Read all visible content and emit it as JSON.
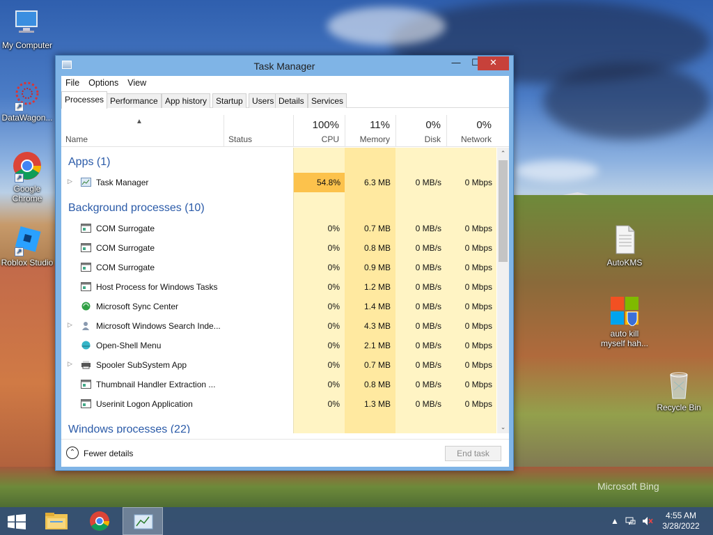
{
  "desktop": {
    "icons": [
      {
        "label": "My Computer"
      },
      {
        "label": "DataWagon..."
      },
      {
        "label": "Google Chrome"
      },
      {
        "label": "Roblox Studio"
      },
      {
        "label": "AutoKMS"
      },
      {
        "label": "auto kill myself hah..."
      },
      {
        "label": "Recycle Bin"
      }
    ],
    "watermark": "Microsoft Bing"
  },
  "window": {
    "title": "Task Manager",
    "controls": {
      "minimize": "—",
      "maximize": "☐",
      "close": "✕"
    },
    "menu": [
      "File",
      "Options",
      "View"
    ],
    "tabs": [
      "Processes",
      "Performance",
      "App history",
      "Startup",
      "Users",
      "Details",
      "Services"
    ],
    "active_tab": "Processes"
  },
  "columns": {
    "name": {
      "label": "Name"
    },
    "status": {
      "label": "Status"
    },
    "cpu": {
      "pct": "100%",
      "label": "CPU"
    },
    "memory": {
      "pct": "11%",
      "label": "Memory"
    },
    "disk": {
      "pct": "0%",
      "label": "Disk"
    },
    "network": {
      "pct": "0%",
      "label": "Network"
    }
  },
  "groups": {
    "apps": "Apps (1)",
    "background": "Background processes (10)",
    "windows": "Windows processes (22)"
  },
  "processes": {
    "apps": [
      {
        "name": "Task Manager",
        "cpu": "54.8%",
        "memory": "6.3 MB",
        "disk": "0 MB/s",
        "network": "0 Mbps",
        "expandable": true
      }
    ],
    "background": [
      {
        "name": "COM Surrogate",
        "cpu": "0%",
        "memory": "0.7 MB",
        "disk": "0 MB/s",
        "network": "0 Mbps"
      },
      {
        "name": "COM Surrogate",
        "cpu": "0%",
        "memory": "0.8 MB",
        "disk": "0 MB/s",
        "network": "0 Mbps"
      },
      {
        "name": "COM Surrogate",
        "cpu": "0%",
        "memory": "0.9 MB",
        "disk": "0 MB/s",
        "network": "0 Mbps"
      },
      {
        "name": "Host Process for Windows Tasks",
        "cpu": "0%",
        "memory": "1.2 MB",
        "disk": "0 MB/s",
        "network": "0 Mbps"
      },
      {
        "name": "Microsoft Sync Center",
        "cpu": "0%",
        "memory": "1.4 MB",
        "disk": "0 MB/s",
        "network": "0 Mbps"
      },
      {
        "name": "Microsoft Windows Search Inde...",
        "cpu": "0%",
        "memory": "4.3 MB",
        "disk": "0 MB/s",
        "network": "0 Mbps"
      },
      {
        "name": "Open-Shell Menu",
        "cpu": "0%",
        "memory": "2.1 MB",
        "disk": "0 MB/s",
        "network": "0 Mbps"
      },
      {
        "name": "Spooler SubSystem App",
        "cpu": "0%",
        "memory": "0.7 MB",
        "disk": "0 MB/s",
        "network": "0 Mbps"
      },
      {
        "name": "Thumbnail Handler Extraction ...",
        "cpu": "0%",
        "memory": "0.8 MB",
        "disk": "0 MB/s",
        "network": "0 Mbps"
      },
      {
        "name": "Userinit Logon Application",
        "cpu": "0%",
        "memory": "1.3 MB",
        "disk": "0 MB/s",
        "network": "0 Mbps"
      }
    ]
  },
  "footer": {
    "fewer_details": "Fewer details",
    "end_task": "End task"
  },
  "taskbar": {
    "time": "4:55 AM",
    "date": "3/28/2022"
  },
  "colors": {
    "heat_light": "#fff4c4",
    "heat_mid": "#ffe9a0",
    "heat_hot": "#fcc24c",
    "group_blue": "#2a5aa8",
    "titlebar": "#7fb4e6"
  }
}
